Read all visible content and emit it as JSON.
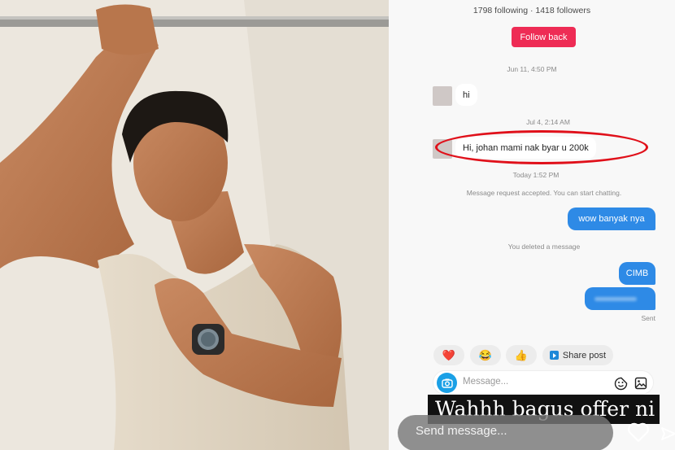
{
  "profile": {
    "follow_stats": "1798 following · 1418 followers",
    "follow_back_label": "Follow back"
  },
  "conversation": {
    "ts1": "Jun 11, 4:50 PM",
    "msg1": "hi",
    "ts2": "Jul 4, 2:14 AM",
    "msg2": "Hi,  johan mami nak byar u 200k",
    "ts3": "Today 1:52 PM",
    "system_accepted": "Message request accepted. You can start chatting.",
    "out1": "wow banyak nya",
    "system_deleted": "You deleted a message",
    "out2": "CIMB",
    "sent_status": "Sent"
  },
  "quick_replies": {
    "heart_emoji": "❤️",
    "laugh_emoji": "😂",
    "thumb_emoji": "👍",
    "share_post_label": "Share post"
  },
  "composer": {
    "placeholder": "Message..."
  },
  "overlay": {
    "caption": "Wahhh bagus offer ni",
    "send_placeholder": "Send message..."
  },
  "colors": {
    "follow_button": "#ee2c55",
    "outgoing_bubble": "#2e8ae6",
    "highlight_ring": "#e0101a",
    "camera_button": "#1aa0e6"
  },
  "icons": [
    "camera-icon",
    "sticker-icon",
    "image-icon",
    "heart-icon",
    "share-arrow-icon",
    "play-icon"
  ]
}
